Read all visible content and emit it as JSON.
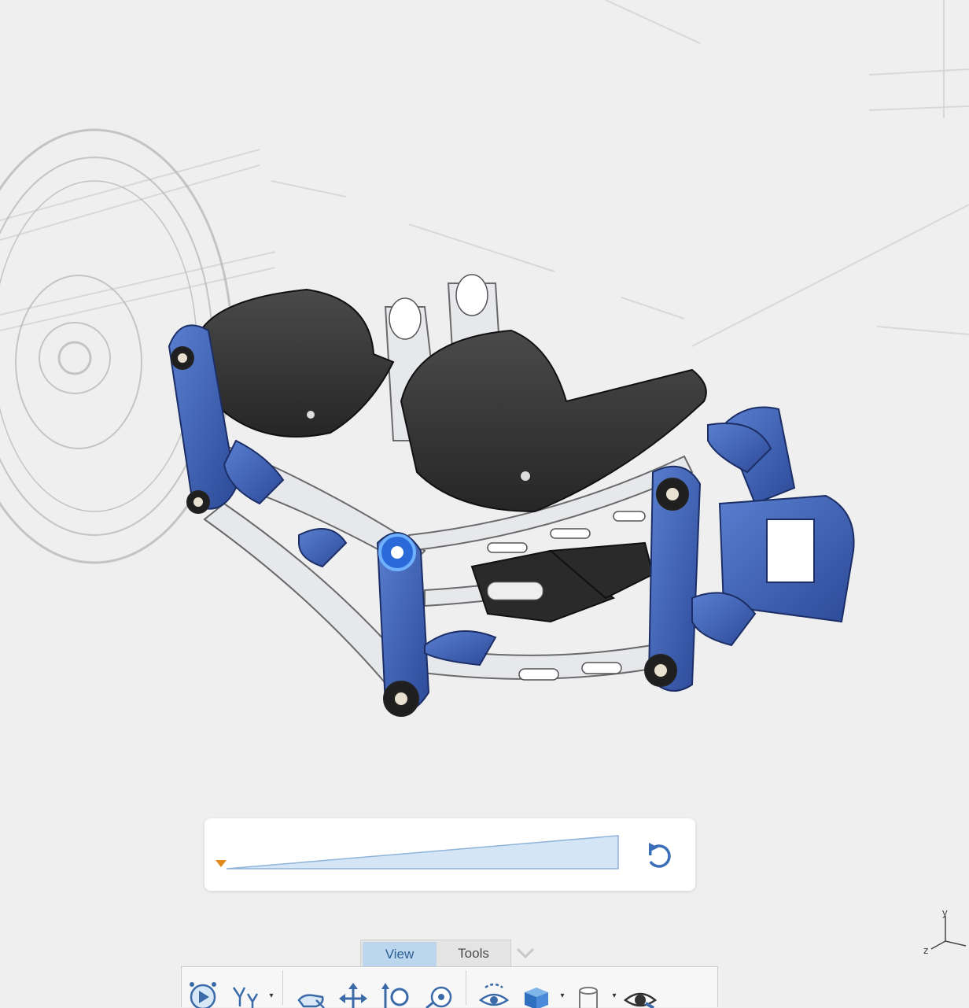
{
  "tabs": [
    {
      "label": "View",
      "active": true
    },
    {
      "label": "Tools",
      "active": false
    }
  ],
  "toolbar": {
    "icons": [
      "play-animation-icon",
      "tree-structure-icon",
      "pan-hand-icon",
      "move-arrows-icon",
      "zoom-icon",
      "zoom-target-icon",
      "look-at-icon",
      "render-mode-cube-icon",
      "cylinder-display-icon",
      "visibility-eye-icon"
    ]
  },
  "triad": {
    "x": "",
    "y": "y",
    "z": "z"
  },
  "colors": {
    "accent_blue": "#3b5db0",
    "tab_active_bg": "#bcd6ee",
    "marker_orange": "#e08a1e",
    "slider_fill": "#d4e6f6"
  },
  "slider": {
    "value": 0
  }
}
